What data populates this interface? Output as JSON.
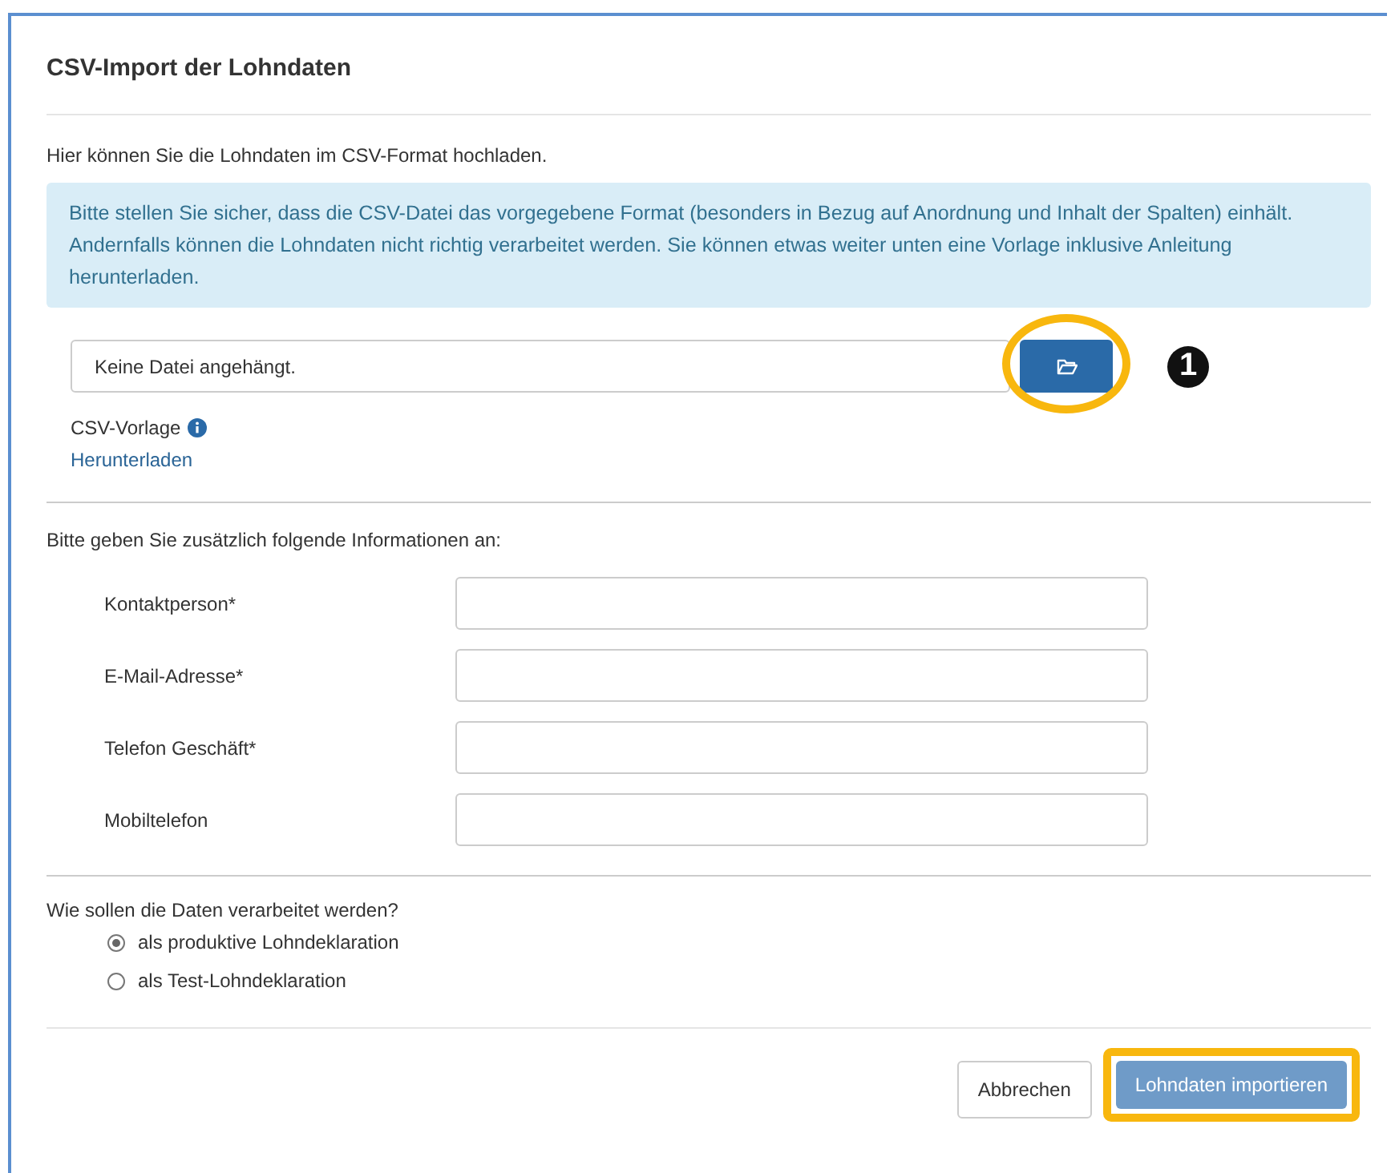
{
  "dialog": {
    "title": "CSV-Import der Lohndaten",
    "intro": "Hier können Sie die Lohndaten im CSV-Format hochladen.",
    "alert": "Bitte stellen Sie sicher, dass die CSV-Datei das vorgegebene Format (besonders in Bezug auf Anordnung und Inhalt der Spalten) einhält. Andernfalls können die Lohndaten nicht richtig verarbeitet werden. Sie können etwas weiter unten eine Vorlage inklusive Anleitung herunterladen.",
    "file_field": {
      "value": "Keine Datei angehängt.",
      "annotation": "1"
    },
    "template": {
      "label": "CSV-Vorlage",
      "link": "Herunterladen"
    },
    "contact_heading": "Bitte geben Sie zusätzlich folgende Informationen an:",
    "fields": [
      {
        "label": "Kontaktperson*"
      },
      {
        "label": "E-Mail-Adresse*"
      },
      {
        "label": "Telefon Geschäft*"
      },
      {
        "label": "Mobiltelefon"
      }
    ],
    "processing": {
      "question": "Wie sollen die Daten verarbeitet werden?",
      "options": [
        {
          "label": "als produktive Lohndeklaration",
          "selected": true
        },
        {
          "label": "als Test-Lohndeklaration",
          "selected": false
        }
      ]
    },
    "buttons": {
      "cancel": "Abbrechen",
      "submit": {
        "label": "Lohndaten importieren",
        "disabled": true
      }
    }
  }
}
